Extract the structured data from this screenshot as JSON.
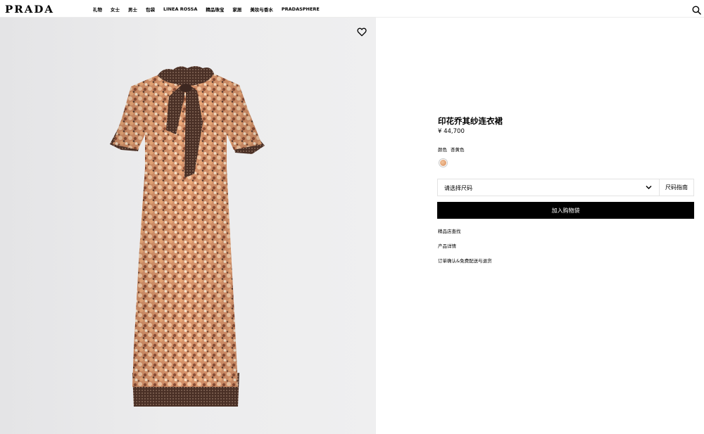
{
  "header": {
    "logo": "PRADA",
    "nav": [
      "礼物",
      "女士",
      "男士",
      "包袋",
      "LINEA ROSSA",
      "精品珠宝",
      "家居",
      "美妆与香水",
      "PRADASPHERE"
    ]
  },
  "product": {
    "title": "印花乔其纱连衣裙",
    "price": "¥ 44,700",
    "color_label": "颜色",
    "color_value": "杏黄色",
    "size_placeholder": "请选择尺码",
    "size_guide": "尺码指南",
    "add_to_bag": "加入购物袋",
    "links": [
      "精品店查找",
      "产品详情",
      "订单确认&免费配送与退货"
    ]
  },
  "colors": {
    "accent": "#000000",
    "dress_orange": "#e0a06c",
    "dress_brown": "#4a3026"
  },
  "icons": [
    "search-icon",
    "heart-icon",
    "chevron-down-icon"
  ]
}
